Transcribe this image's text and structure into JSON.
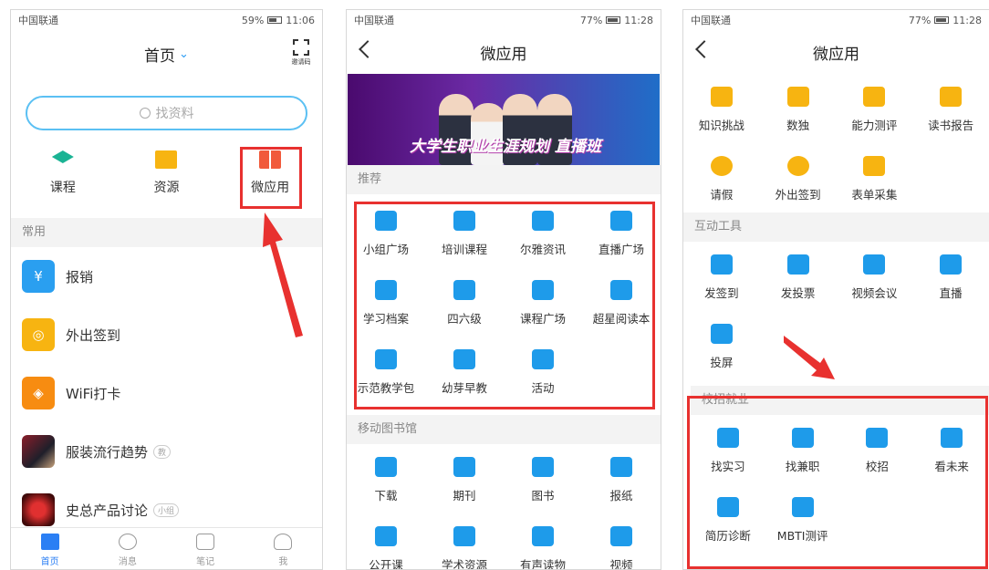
{
  "colors": {
    "accent": "#2b9cf4",
    "highlight": "#e8312f",
    "icon_blue": "#1e9bea",
    "icon_orange": "#f7b411"
  },
  "p1": {
    "status": {
      "carrier": "中国联通",
      "battery": "59%",
      "time": "11:06"
    },
    "title": "首页",
    "scan_label": "邀请码",
    "search_placeholder": "找资料",
    "top_items": [
      {
        "label": "课程",
        "icon": "graduation-cap-icon"
      },
      {
        "label": "资源",
        "icon": "folder-icon"
      },
      {
        "label": "微应用",
        "icon": "apps-grid-icon"
      }
    ],
    "section": "常用",
    "list": [
      {
        "label": "报销",
        "icon": "money-bag-icon",
        "tag": ""
      },
      {
        "label": "外出签到",
        "icon": "location-icon",
        "tag": ""
      },
      {
        "label": "WiFi打卡",
        "icon": "wifi-icon",
        "tag": ""
      },
      {
        "label": "服装流行趋势",
        "icon": "fashion-thumbnail",
        "tag": "教"
      },
      {
        "label": "史总产品讨论",
        "icon": "product-thumbnail",
        "tag": "小组"
      }
    ],
    "tabs": [
      "首页",
      "消息",
      "笔记",
      "我"
    ]
  },
  "p2": {
    "status": {
      "carrier": "中国联通",
      "battery": "77%",
      "time": "11:28"
    },
    "title": "微应用",
    "banner_text": "大学生职业生涯规划 直播班",
    "section_recommend": "推荐",
    "recommend": [
      "小组广场",
      "培训课程",
      "尔雅资讯",
      "直播广场",
      "学习档案",
      "四六级",
      "课程广场",
      "超星阅读本",
      "示范教学包",
      "幼芽早教",
      "活动"
    ],
    "section_library": "移动图书馆",
    "library": [
      "下载",
      "期刊",
      "图书",
      "报纸",
      "公开课",
      "学术资源",
      "有声读物",
      "视频"
    ]
  },
  "p3": {
    "status": {
      "carrier": "中国联通",
      "battery": "77%",
      "time": "11:28"
    },
    "title": "微应用",
    "apps_top": [
      {
        "label": "知识挑战",
        "color": "#f7b411"
      },
      {
        "label": "数独",
        "color": "#f7b411"
      },
      {
        "label": "能力测评",
        "color": "#f7b411"
      },
      {
        "label": "读书报告",
        "color": "#f7b411"
      },
      {
        "label": "请假",
        "color": "#f7b411"
      },
      {
        "label": "外出签到",
        "color": "#f7b411"
      },
      {
        "label": "表单采集",
        "color": "#f7b411"
      }
    ],
    "section_interact": "互动工具",
    "interact": [
      "发签到",
      "发投票",
      "视频会议",
      "直播",
      "投屏"
    ],
    "section_campus": "校招就业",
    "campus": [
      "找实习",
      "找兼职",
      "校招",
      "看未来",
      "简历诊断",
      "MBTI测评"
    ]
  }
}
